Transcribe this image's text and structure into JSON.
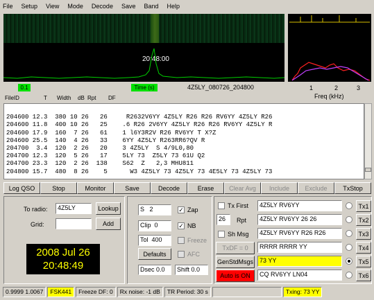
{
  "menu": [
    "File",
    "Setup",
    "View",
    "Mode",
    "Decode",
    "Save",
    "Band",
    "Help"
  ],
  "waterfall": {
    "time_label": "20:48:00",
    "seconds_label": "0.1",
    "time_button": "Time (s)",
    "filename": "4Z5LY_080726_204800"
  },
  "freq_axis": {
    "label": "Freq (kHz)",
    "ticks": [
      "1",
      "2",
      "3"
    ]
  },
  "decode_list": {
    "columns": [
      "FileID",
      "T",
      "Width",
      "dB",
      "Rpt",
      "DF"
    ],
    "rows": [
      "204600 12.3  380 10 26   26     R2632V6YY 4Z5LY R26 R26 RV6YY 4Z5LY R26",
      "204600 11.8  400 10 26   25    .6 R26 2V6YY 4Z5LY R26 R26 RV6YY 4Z5LY R",
      "204600 17.9  160  7 26   61    1 l6Y3R2V R26 RV6YY T X?Z",
      "204600 25.5  140  4 26   33    6YY 4Z5LY R263RR6?QV R",
      "204700  3.4  120  2 26   20    3 4Z5LY  S 4/9L0,80",
      "204700 12.3  120  5 26   17    5LY 73  Z5LY 73 61U Q2",
      "204700 23.3  120  2 26  138    S62  Z   2,3 MHU811",
      "204800 15.7  480  8 26    5      W3 4Z5LY 73 4Z5LY 73 4E5LY 73 4Z5LY 73"
    ]
  },
  "buttons": {
    "log_qso": "Log QSO",
    "stop": "Stop",
    "monitor": "Monitor",
    "save": "Save",
    "decode": "Decode",
    "erase": "Erase",
    "clear_avg": "Clear Avg",
    "include": "Include",
    "exclude": "Exclude",
    "txstop": "TxStop"
  },
  "left": {
    "to_radio_label": "To radio:",
    "to_radio_value": "4Z5LY",
    "lookup": "Lookup",
    "grid_label": "Grid:",
    "grid_value": "",
    "add": "Add",
    "date": "2008 Jul 26",
    "time": "20:48:49"
  },
  "mid": {
    "s_label": "S",
    "s_value": "2",
    "zap": "Zap",
    "clip_label": "Clip",
    "clip_value": "0",
    "nb": "NB",
    "tol_label": "Tol",
    "tol_value": "400",
    "freeze": "Freeze",
    "defaults": "Defaults",
    "afc": "AFC",
    "dsec_label": "Dsec",
    "dsec_value": "0.0",
    "shift_label": "Shift",
    "shift_value": "0.0"
  },
  "right": {
    "tx_first": "Tx First",
    "rpt_value": "26",
    "rpt_label": "Rpt",
    "sh_msg": "Sh Msg",
    "txdf": "TxDF = 0",
    "gen_std": "GenStdMsgs",
    "auto_on": "Auto is ON",
    "messages": [
      "4Z5LY RV6YY",
      "4Z5LY RV6YY 26 26",
      "4Z5LY RV6YY R26 R26",
      "RRRR RRRR YY",
      "73 YY",
      "CQ RV6YY LN04"
    ],
    "tx_buttons": [
      "Tx1",
      "Tx2",
      "Tx3",
      "Tx4",
      "Tx5",
      "Tx6"
    ],
    "highlight_color": "#ffff00",
    "auto_color": "#ff0000"
  },
  "status": {
    "ratio": "0.9999 1.0067",
    "mode": "FSK441",
    "freeze_df": "Freeze DF:  0",
    "rx_noise": "Rx noise: -1 dB",
    "tr_period": "TR Period: 30 s",
    "txing": "Txing:  73 YY"
  }
}
